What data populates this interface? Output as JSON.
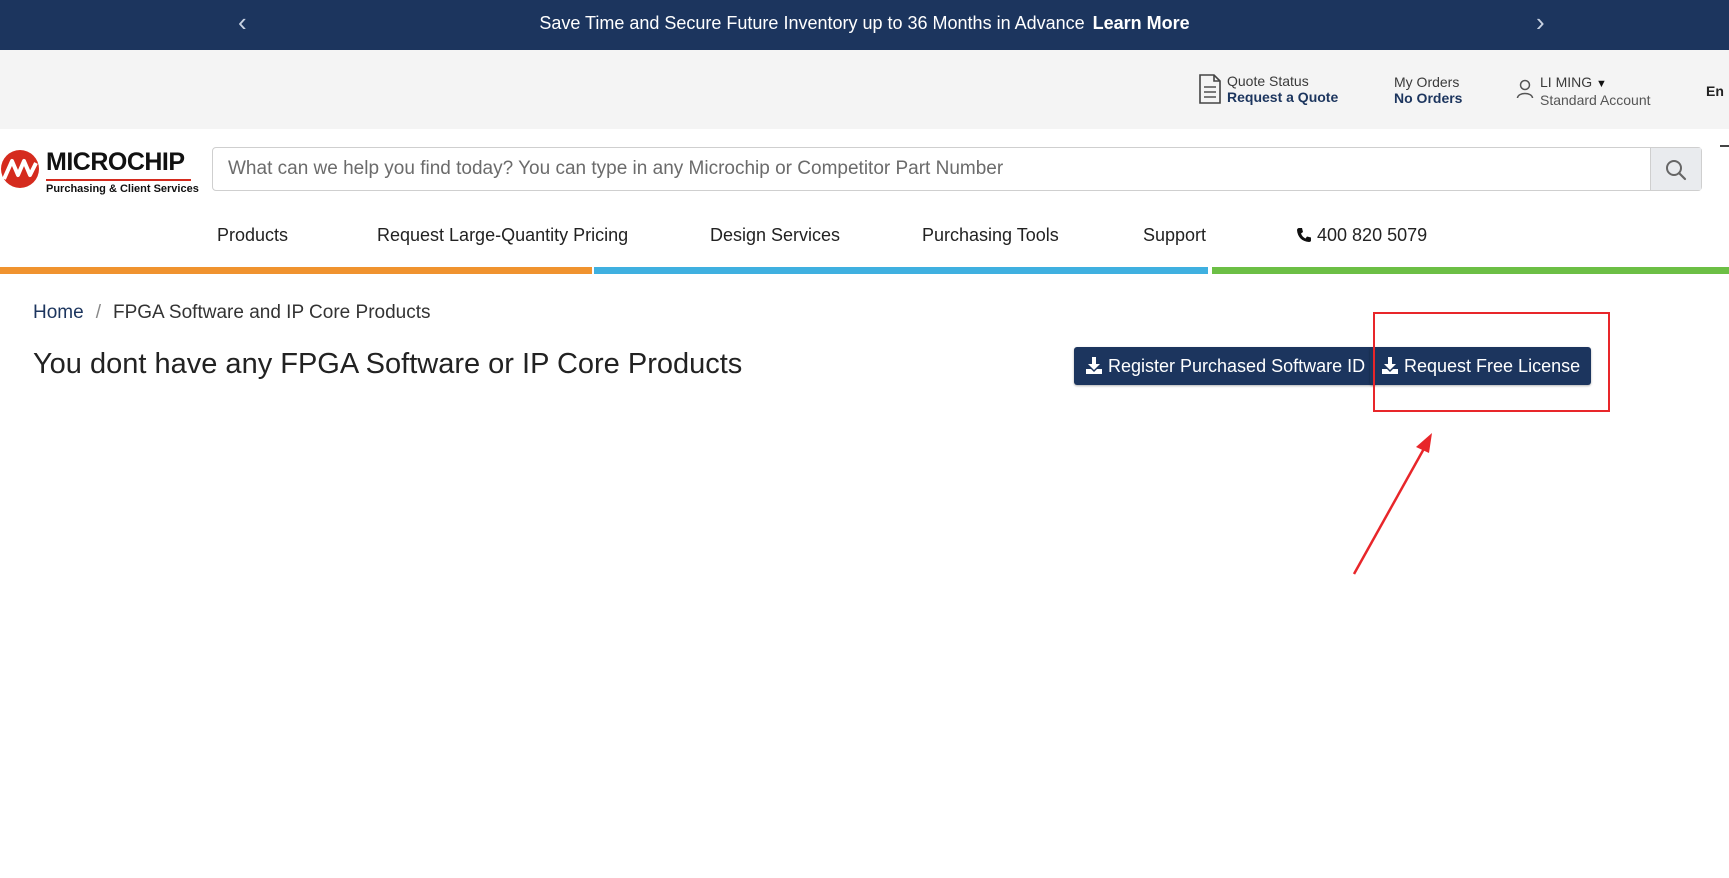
{
  "banner": {
    "message": "Save Time and Secure Future Inventory up to 36 Months in Advance",
    "link": "Learn More",
    "prev_icon": "chevron-left-icon",
    "next_icon": "chevron-right-icon"
  },
  "topbar": {
    "quote_status_label": "Quote Status",
    "quote_link": "Request a Quote",
    "orders_label": "My Orders",
    "orders_value": "No Orders",
    "user_name": "LI MING",
    "account_type": "Standard Account",
    "language": "En"
  },
  "logo": {
    "brand": "MICROCHIP",
    "subtitle": "Purchasing & Client Services"
  },
  "search": {
    "placeholder": "What can we help you find today? You can type in any Microchip or Competitor Part Number"
  },
  "nav": {
    "products": "Products",
    "pricing": "Request Large-Quantity Pricing",
    "design": "Design Services",
    "tools": "Purchasing Tools",
    "support": "Support",
    "phone": "400 820 5079"
  },
  "breadcrumb": {
    "home": "Home",
    "separator": "/",
    "current": "FPGA Software and IP Core Products"
  },
  "main": {
    "title": "You dont have any FPGA Software or IP Core Products",
    "register_button": "Register Purchased Software ID",
    "request_button": "Request Free License"
  },
  "colors": {
    "brand_navy": "#1c355e",
    "stripe_orange": "#f0932f",
    "stripe_blue": "#3fb0e0",
    "stripe_green": "#6cbf45",
    "annotation_red": "#e8262a"
  }
}
